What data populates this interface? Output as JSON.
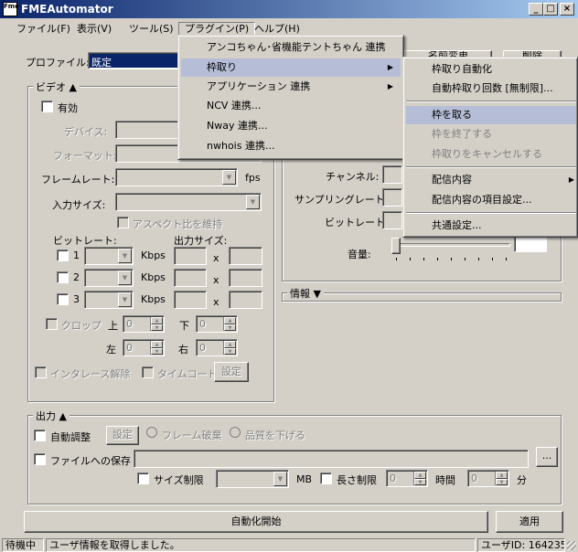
{
  "window": {
    "title": "FMEAutomator",
    "icon_text": "Fme",
    "controls": [
      "_",
      "□",
      "×"
    ]
  },
  "menubar": [
    {
      "label": "ファイル(F)"
    },
    {
      "label": "表示(V)"
    },
    {
      "label": "ツール(S)"
    },
    {
      "label": "プラグイン(P)"
    },
    {
      "label": "ヘルプ(H)"
    }
  ],
  "plugin_menu": {
    "items": [
      {
        "label": "アンコちゃん･省機能テントちゃん 連携"
      },
      {
        "label": "枠取り"
      },
      {
        "label": "アプリケーション 連携"
      },
      {
        "label": "NCV 連携..."
      },
      {
        "label": "Nway 連携..."
      },
      {
        "label": "nwhois 連携..."
      }
    ]
  },
  "wakudori_menu": {
    "items": [
      {
        "label": "枠取り自動化"
      },
      {
        "label": "自動枠取り回数 [無制限]..."
      },
      {
        "label": "枠を取る"
      },
      {
        "label": "枠を終了する"
      },
      {
        "label": "枠取りをキャンセルする"
      },
      {
        "label": "配信内容"
      },
      {
        "label": "配信内容の項目設定..."
      },
      {
        "label": "共通設定..."
      }
    ]
  },
  "hidden_buttons": {
    "b1": "名前変更",
    "b2": "削除"
  },
  "profile": {
    "label": "プロファイル:",
    "value": "既定"
  },
  "video": {
    "title": "ビデオ ▲",
    "enable_label": "有効",
    "device_label": "デバイス:",
    "format_label": "フォーマット:",
    "framerate_label": "フレームレート:",
    "fps": "fps",
    "input_size_label": "入力サイズ:",
    "keep_aspect_label": "アスペクト比を維持",
    "bitrate_label": "ビットレート:",
    "output_size_label": "出力サイズ:",
    "rows": [
      {
        "num": "1",
        "unit": "Kbps",
        "x": "x"
      },
      {
        "num": "2",
        "unit": "Kbps",
        "x": "x"
      },
      {
        "num": "3",
        "unit": "Kbps",
        "x": "x"
      }
    ],
    "crop_label": "クロップ",
    "top_label": "上",
    "bottom_label": "下",
    "left_label": "左",
    "right_label": "右",
    "crop_values": [
      "0",
      "0",
      "0",
      "0"
    ],
    "deinterlace_label": "インタレース解除",
    "timecode_label": "タイムコード",
    "settings_label": "設定"
  },
  "audio": {
    "channel_label": "チャンネル:",
    "sampling_label": "サンプリングレート:",
    "bitrate_label": "ビットレート:",
    "volume_label": "音量:"
  },
  "info": {
    "title": "情報 ▼"
  },
  "output": {
    "title": "出力 ▲",
    "auto_adjust_label": "自動調整",
    "settings_label": "設定",
    "frame_drop_label": "フレーム破棄",
    "quality_down_label": "品質を下げる",
    "save_file_label": "ファイルへの保存",
    "browse_label": "...",
    "size_limit_label": "サイズ制限",
    "mb": "MB",
    "length_limit_label": "長さ制限",
    "hours_value": "0",
    "hours_unit": "時間",
    "minutes_value": "0",
    "minutes_unit": "分"
  },
  "footer": {
    "start_label": "自動化開始",
    "apply_label": "適用"
  },
  "status": {
    "state": "待機中",
    "message": "ユーザ情報を取得しました。",
    "user_id": "ユーザID: 164235"
  }
}
